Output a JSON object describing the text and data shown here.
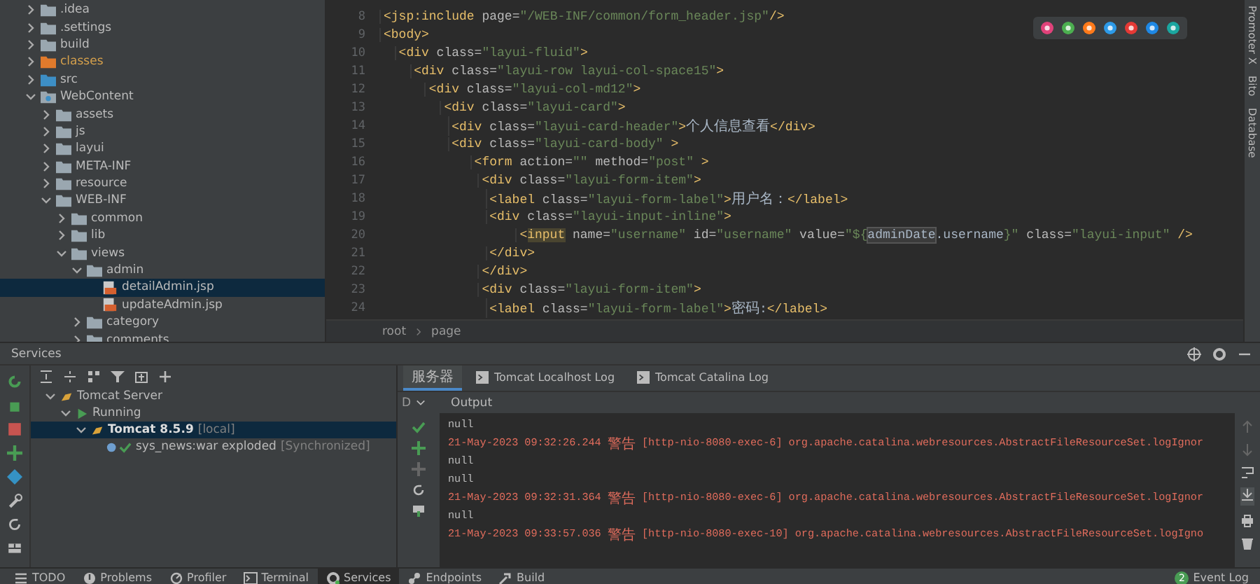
{
  "project_tree": {
    "items": [
      {
        "label": ".idea",
        "kind": "folder",
        "expanded": false,
        "selected": false
      },
      {
        "label": ".settings",
        "kind": "folder",
        "expanded": false,
        "selected": false
      },
      {
        "label": "build",
        "kind": "folder",
        "expanded": false,
        "selected": false
      },
      {
        "label": "classes",
        "kind": "excluded_folder",
        "expanded": false,
        "selected": false
      },
      {
        "label": "src",
        "kind": "source_folder",
        "expanded": false,
        "selected": false
      },
      {
        "label": "WebContent",
        "kind": "web_folder",
        "expanded": true,
        "selected": false,
        "children": [
          {
            "label": "assets",
            "kind": "folder",
            "expanded": false,
            "selected": false
          },
          {
            "label": "js",
            "kind": "folder",
            "expanded": false,
            "selected": false
          },
          {
            "label": "layui",
            "kind": "folder",
            "expanded": false,
            "selected": false
          },
          {
            "label": "META-INF",
            "kind": "folder",
            "expanded": false,
            "selected": false
          },
          {
            "label": "resource",
            "kind": "folder",
            "expanded": false,
            "selected": false
          },
          {
            "label": "WEB-INF",
            "kind": "folder",
            "expanded": true,
            "selected": false,
            "children": [
              {
                "label": "common",
                "kind": "folder",
                "expanded": false,
                "selected": false
              },
              {
                "label": "lib",
                "kind": "folder",
                "expanded": false,
                "selected": false
              },
              {
                "label": "views",
                "kind": "folder",
                "expanded": true,
                "selected": false,
                "children": [
                  {
                    "label": "admin",
                    "kind": "folder",
                    "expanded": true,
                    "selected": false,
                    "children": [
                      {
                        "label": "detailAdmin.jsp",
                        "kind": "jsp_file",
                        "selected": true
                      },
                      {
                        "label": "updateAdmin.jsp",
                        "kind": "jsp_file",
                        "selected": false
                      }
                    ]
                  },
                  {
                    "label": "category",
                    "kind": "folder",
                    "expanded": false,
                    "selected": false
                  },
                  {
                    "label": "comments",
                    "kind": "folder",
                    "expanded": false,
                    "selected": false
                  }
                ]
              }
            ]
          }
        ]
      }
    ]
  },
  "editor": {
    "lines": [
      {
        "number": "8",
        "segments": [
          {
            "kind": "tag",
            "text": "<jsp:include"
          },
          {
            "kind": "attr",
            "text": " page="
          },
          {
            "kind": "value",
            "text": "\"/WEB-INF/common/form_header.jsp\""
          },
          {
            "kind": "tag",
            "text": "/>"
          }
        ]
      },
      {
        "number": "9",
        "segments": [
          {
            "kind": "tag",
            "text": "<body>"
          }
        ]
      },
      {
        "number": "10",
        "segments": [
          {
            "kind": "tag",
            "text": "  <div"
          },
          {
            "kind": "attr",
            "text": " class="
          },
          {
            "kind": "value",
            "text": "\"layui-fluid\""
          },
          {
            "kind": "tag",
            "text": ">"
          }
        ]
      },
      {
        "number": "11",
        "segments": [
          {
            "kind": "tag",
            "text": "    <div"
          },
          {
            "kind": "attr",
            "text": " class="
          },
          {
            "kind": "value",
            "text": "\"layui-row layui-col-space15\""
          },
          {
            "kind": "tag",
            "text": ">"
          }
        ]
      },
      {
        "number": "12",
        "segments": [
          {
            "kind": "tag",
            "text": "      <div"
          },
          {
            "kind": "attr",
            "text": " class="
          },
          {
            "kind": "value",
            "text": "\"layui-col-md12\""
          },
          {
            "kind": "tag",
            "text": ">"
          }
        ]
      },
      {
        "number": "13",
        "segments": [
          {
            "kind": "tag",
            "text": "        <div"
          },
          {
            "kind": "attr",
            "text": " class="
          },
          {
            "kind": "value",
            "text": "\"layui-card\""
          },
          {
            "kind": "tag",
            "text": ">"
          }
        ]
      },
      {
        "number": "14",
        "segments": [
          {
            "kind": "tag",
            "text": "         <div"
          },
          {
            "kind": "attr",
            "text": " class="
          },
          {
            "kind": "value",
            "text": "\"layui-card-header\""
          },
          {
            "kind": "tag",
            "text": ">"
          },
          {
            "kind": "text",
            "text": "个人信息查看"
          },
          {
            "kind": "tag",
            "text": "</div>"
          }
        ]
      },
      {
        "number": "15",
        "segments": [
          {
            "kind": "tag",
            "text": "         <div"
          },
          {
            "kind": "attr",
            "text": " class="
          },
          {
            "kind": "value",
            "text": "\"layui-card-body\""
          },
          {
            "kind": "tag",
            "text": " >"
          }
        ]
      },
      {
        "number": "16",
        "segments": [
          {
            "kind": "tag",
            "text": "            <form"
          },
          {
            "kind": "attr",
            "text": " action="
          },
          {
            "kind": "value",
            "text": "\"\""
          },
          {
            "kind": "attr",
            "text": " method="
          },
          {
            "kind": "value",
            "text": "\"post\""
          },
          {
            "kind": "tag",
            "text": " >"
          }
        ]
      },
      {
        "number": "17",
        "segments": [
          {
            "kind": "tag",
            "text": "             <div"
          },
          {
            "kind": "attr",
            "text": " class="
          },
          {
            "kind": "value",
            "text": "\"layui-form-item\""
          },
          {
            "kind": "tag",
            "text": ">"
          }
        ]
      },
      {
        "number": "18",
        "segments": [
          {
            "kind": "tag",
            "text": "              <label"
          },
          {
            "kind": "attr",
            "text": " class="
          },
          {
            "kind": "value",
            "text": "\"layui-form-label\""
          },
          {
            "kind": "tag",
            "text": ">"
          },
          {
            "kind": "text",
            "text": "用户名："
          },
          {
            "kind": "tag",
            "text": "</label>"
          }
        ]
      },
      {
        "number": "19",
        "segments": [
          {
            "kind": "tag",
            "text": "              <div"
          },
          {
            "kind": "attr",
            "text": " class="
          },
          {
            "kind": "value",
            "text": "\"layui-input-inline\""
          },
          {
            "kind": "tag",
            "text": ">"
          }
        ]
      },
      {
        "number": "20",
        "segments": [
          {
            "kind": "tag",
            "text": "                  <"
          },
          {
            "kind": "tag_match",
            "text": "input"
          },
          {
            "kind": "attr",
            "text": " name="
          },
          {
            "kind": "value",
            "text": "\"username\""
          },
          {
            "kind": "attr",
            "text": " id="
          },
          {
            "kind": "value",
            "text": "\"username\""
          },
          {
            "kind": "attr",
            "text": " value="
          },
          {
            "kind": "value",
            "text": "\"${"
          },
          {
            "kind": "text_match",
            "text": "adminDate"
          },
          {
            "kind": "text",
            "text": ".username"
          },
          {
            "kind": "value",
            "text": "}\""
          },
          {
            "kind": "attr",
            "text": " class="
          },
          {
            "kind": "value",
            "text": "\"layui-input\""
          },
          {
            "kind": "tag",
            "text": " />"
          }
        ]
      },
      {
        "number": "21",
        "segments": [
          {
            "kind": "tag",
            "text": "              </div>"
          }
        ]
      },
      {
        "number": "22",
        "segments": [
          {
            "kind": "tag",
            "text": "             </div>"
          }
        ]
      },
      {
        "number": "23",
        "segments": [
          {
            "kind": "tag",
            "text": "             <div"
          },
          {
            "kind": "attr",
            "text": " class="
          },
          {
            "kind": "value",
            "text": "\"layui-form-item\""
          },
          {
            "kind": "tag",
            "text": ">"
          }
        ]
      },
      {
        "number": "24",
        "segments": [
          {
            "kind": "tag",
            "text": "              <label"
          },
          {
            "kind": "attr",
            "text": " class="
          },
          {
            "kind": "value",
            "text": "\"layui-form-label\""
          },
          {
            "kind": "tag",
            "text": ">"
          },
          {
            "kind": "text",
            "text": "密码:"
          },
          {
            "kind": "tag",
            "text": "</label>"
          }
        ]
      }
    ],
    "breadcrumbs": [
      "root",
      "page"
    ]
  },
  "side_strip": [
    "Promoter X",
    "Bito",
    "Database"
  ],
  "services": {
    "title": "Services",
    "tree": [
      {
        "label": "Tomcat Server",
        "kind": "server",
        "expanded": true,
        "selected": false,
        "children": [
          {
            "label": "Running",
            "kind": "running",
            "expanded": true,
            "selected": false,
            "children": [
              {
                "label": "Tomcat 8.5.9",
                "note": "[local]",
                "kind": "tomcat",
                "expanded": true,
                "selected": true,
                "children": [
                  {
                    "label": "sys_news:war exploded",
                    "note": "[Synchronized]",
                    "kind": "artifact",
                    "selected": false
                  }
                ]
              }
            ]
          }
        ]
      }
    ],
    "tabs": [
      {
        "label": "服务器",
        "selected": true
      },
      {
        "label": "Tomcat Localhost Log",
        "selected": false
      },
      {
        "label": "Tomcat Catalina Log",
        "selected": false
      }
    ],
    "dropdown": "D",
    "output_title": "Output",
    "output": [
      {
        "kind": "plain",
        "text": "null"
      },
      {
        "kind": "warning",
        "text": "21-May-2023 09:32:26.244 警告 [http-nio-8080-exec-6] org.apache.catalina.webresources.AbstractFileResourceSet.logIgnor"
      },
      {
        "kind": "plain",
        "text": "null"
      },
      {
        "kind": "plain",
        "text": "null"
      },
      {
        "kind": "warning",
        "text": "21-May-2023 09:32:31.364 警告 [http-nio-8080-exec-6] org.apache.catalina.webresources.AbstractFileResourceSet.logIgnor"
      },
      {
        "kind": "plain",
        "text": "null"
      },
      {
        "kind": "warning",
        "text": "21-May-2023 09:33:57.036 警告 [http-nio-8080-exec-10] org.apache.catalina.webresources.AbstractFileResourceSet.logIgno"
      }
    ]
  },
  "bottom_bar": {
    "tabs": [
      {
        "label": "TODO",
        "selected": false
      },
      {
        "label": "Problems",
        "selected": false
      },
      {
        "label": "Profiler",
        "selected": false
      },
      {
        "label": "Terminal",
        "selected": false
      },
      {
        "label": "Services",
        "selected": true
      },
      {
        "label": "Endpoints",
        "selected": false
      },
      {
        "label": "Build",
        "selected": false
      }
    ],
    "event_count": "2",
    "event_log": "Event Log"
  }
}
